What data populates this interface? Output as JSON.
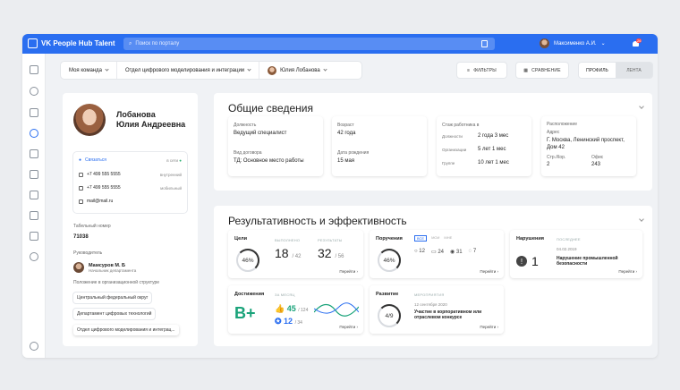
{
  "header": {
    "app_title": "VK People Hub Talent",
    "search_placeholder": "Поиск по порталу",
    "user_name": "Максименко А.И.",
    "notif_count": "26"
  },
  "filters": {
    "team": "Моя команда",
    "department": "Отдел цифрового моделирования и интеграции",
    "employee": "Юлия Лобанова"
  },
  "toolbar": {
    "filters_label": "ФИЛЬТРЫ",
    "compare_label": "СРАВНЕНИЕ",
    "profile_tab": "ПРОФИЛЬ",
    "feed_tab": "ЛЕНТА"
  },
  "profile": {
    "last_name": "Лобанова",
    "first_middle": "Юлия Андреевна",
    "contact_link": "Связаться",
    "status": "в сети",
    "phone1": "+7 499 555 5555",
    "phone1_type": "внутренний",
    "phone2": "+7 499 555 5555",
    "phone2_type": "мобильный",
    "email": "mail@mail.ru",
    "tab_label": "Табельный номер",
    "tab_number": "71038",
    "manager_label": "Руководитель",
    "manager_name": "Мамсуров М. Б",
    "manager_role": "Начальник департамента",
    "org_label": "Положение в организационной структуре",
    "org": [
      "Центральный федеральный округ",
      "Департамент цифровых технологий",
      "Отдел цифрового моделирования и интегрaц..."
    ]
  },
  "general": {
    "title": "Общие сведения",
    "position_label": "Должность",
    "position": "Ведущий специалист",
    "contract_label": "Вид договора",
    "contract": "ТД: Основное место работы",
    "age_label": "Возраст",
    "age": "42 года",
    "birth_label": "Дата рождения",
    "birth": "15 мая",
    "exp_label": "Стаж работника в",
    "exp_rows": [
      {
        "k": "Должности",
        "v": "2 года 3 мес"
      },
      {
        "k": "Организации",
        "v": "5 лет 1 мес"
      },
      {
        "k": "Группе",
        "v": "10 лет 1 мес"
      }
    ],
    "loc_label": "Расположение",
    "addr_label": "Адрес",
    "addr": "Г. Москва, Ленинский проспект, Дом 42",
    "floor_label": "Стр./Кор.",
    "floor": "2",
    "office_label": "Офис",
    "office": "243"
  },
  "perf": {
    "title": "Результативность и эффективность",
    "goals": {
      "title": "Цели",
      "percent": "46%",
      "done_label": "ВЫПОЛНЕНО",
      "done": "18",
      "done_total": "/ 42",
      "res_label": "РЕЗУЛЬТАТЫ",
      "res": "32",
      "res_total": "/ 56",
      "go": "Перейти"
    },
    "tasks": {
      "title": "Поручения",
      "tabs": [
        "ВСЕ",
        "МОИ",
        "МНЕ"
      ],
      "percent": "46%",
      "counts": [
        "12",
        "24",
        "31",
        "7"
      ],
      "go": "Перейти"
    },
    "viol": {
      "title": "Нарушения",
      "last_label": "ПОСЛЕДНЕЕ",
      "count": "1",
      "date": "04.02.2019",
      "text": "Нарушение промышленной безопасности",
      "go": "Перейти"
    },
    "ach": {
      "title": "Достижения",
      "period": "ЗА МЕСЯЦ",
      "grade": "B+",
      "likes": "45",
      "likes_total": "/ 124",
      "awards": "12",
      "awards_total": "/ 34",
      "go": "Перейти"
    },
    "dev": {
      "title": "Развитие",
      "events_label": "МЕРОПРИЯТИЯ",
      "ratio": "4/9",
      "date": "12 сентября 2020",
      "text": "Участие в корпоративном или отраслевом конкурсе",
      "go": "Перейти"
    }
  }
}
